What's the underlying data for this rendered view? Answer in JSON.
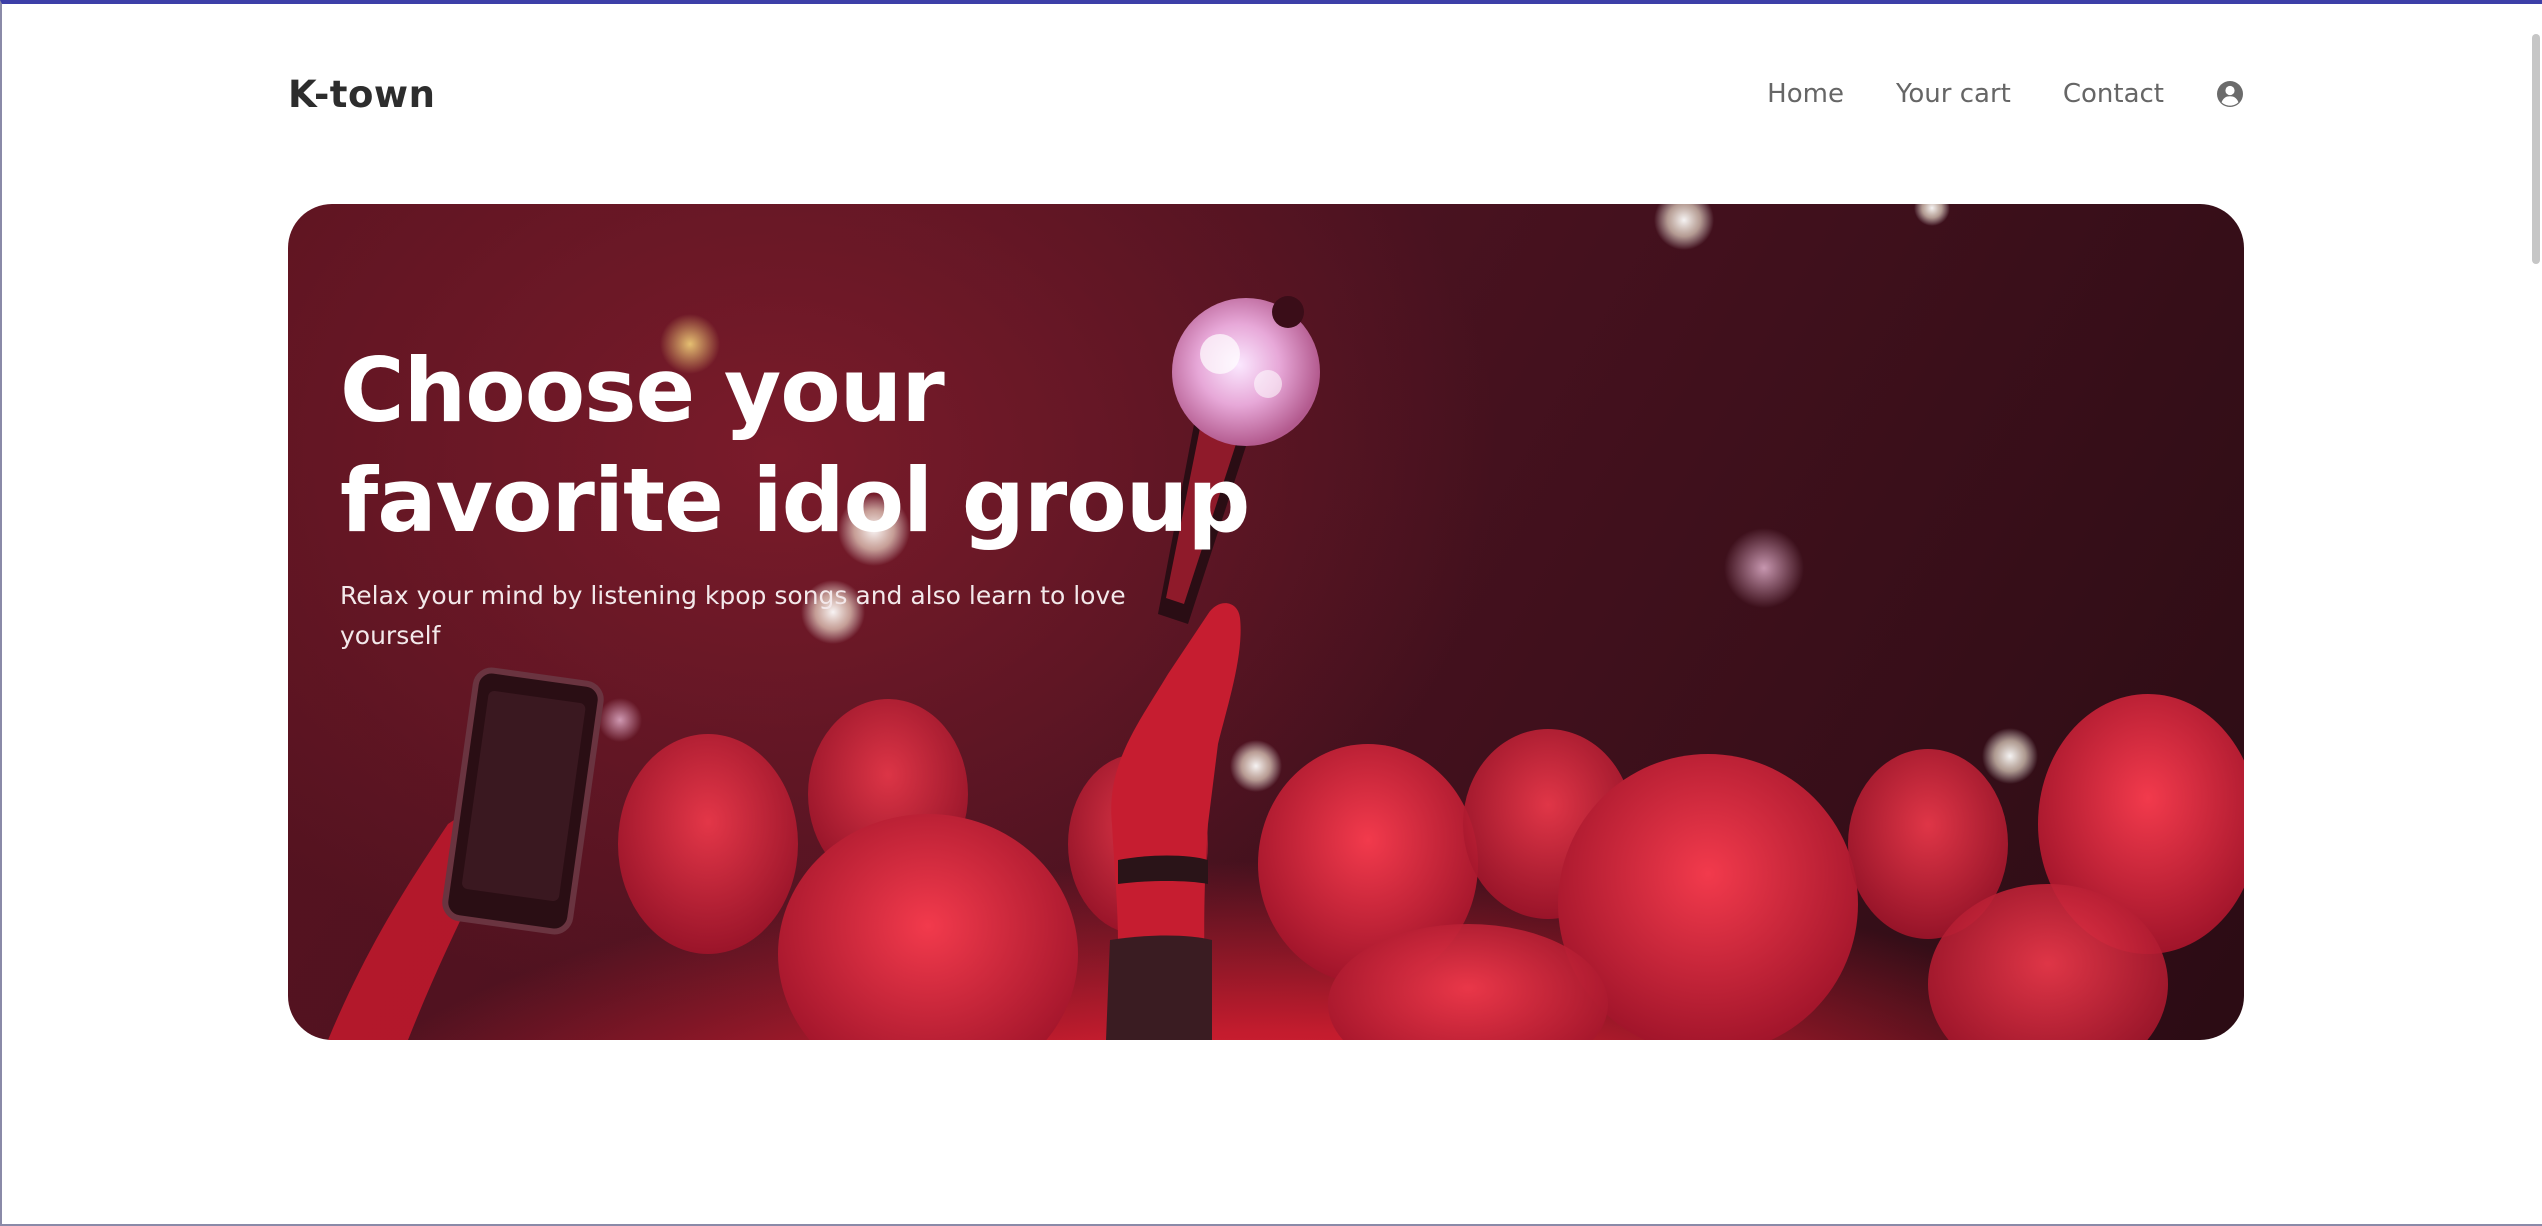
{
  "header": {
    "logo": "K-town",
    "nav": [
      {
        "label": "Home"
      },
      {
        "label": "Your cart"
      },
      {
        "label": "Contact"
      }
    ],
    "account_icon": "user-circle-icon"
  },
  "hero": {
    "title": "Choose your favorite idol group",
    "subtitle": "Relax your mind by listening kpop songs and also learn to love yourself",
    "image_description": "concert crowd with light stick under red lights"
  },
  "colors": {
    "accent_border": "#3d3fa8",
    "text_dark": "#2d2d2d",
    "nav_text": "#666666",
    "hero_red": "#e62a3e"
  }
}
